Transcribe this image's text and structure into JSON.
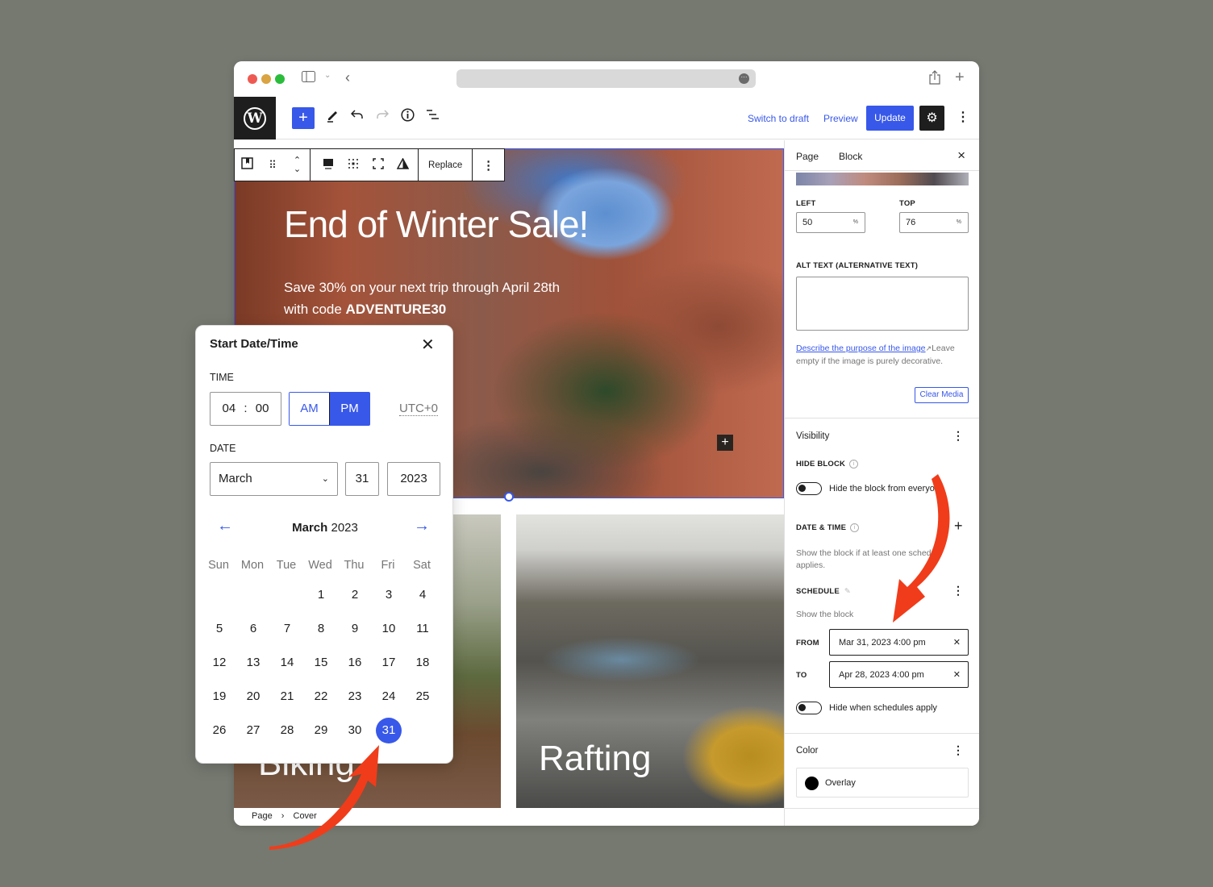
{
  "browser": {
    "window_controls": [
      "close",
      "minimize",
      "zoom"
    ],
    "icons": [
      "sidebar-toggle-icon",
      "chevron-down-icon",
      "back-icon",
      "share-icon",
      "new-tab-icon"
    ]
  },
  "toolbar": {
    "add_label": "+",
    "switch_to_draft": "Switch to draft",
    "preview": "Preview",
    "update": "Update"
  },
  "block_toolbar": {
    "replace": "Replace"
  },
  "hero": {
    "title": "End of Winter Sale!",
    "subtitle_line1": "Save 30% on your next trip through April 28th",
    "subtitle_line2_prefix": "with code ",
    "subtitle_code": "ADVENTURE30"
  },
  "tiles": [
    {
      "title": "Biking"
    },
    {
      "title": "Rafting"
    }
  ],
  "breadcrumb": {
    "items": [
      "Page",
      "Cover"
    ],
    "separator": "›"
  },
  "sidebar": {
    "tabs": [
      {
        "label": "Page"
      },
      {
        "label": "Block",
        "active": true
      }
    ],
    "focal_point": {
      "left_label": "LEFT",
      "left_value": "50",
      "top_label": "TOP",
      "top_value": "76",
      "unit": "%"
    },
    "alt_text": {
      "label": "ALT TEXT (ALTERNATIVE TEXT)",
      "value": "",
      "help_link": "Describe the purpose of the image",
      "help_text": "Leave empty if the image is purely decorative."
    },
    "clear_media": "Clear Media",
    "visibility": {
      "title": "Visibility",
      "hide_block_label": "HIDE BLOCK",
      "hide_toggle_label": "Hide the block from everyone",
      "hide_toggle_on": false,
      "date_time_label": "DATE & TIME",
      "date_time_help": "Show the block if at least one schedule applies.",
      "schedule_label": "SCHEDULE",
      "schedule_sub": "Show the block",
      "from_label": "FROM",
      "from_value": "Mar 31, 2023 4:00 pm",
      "to_label": "TO",
      "to_value": "Apr 28, 2023 4:00 pm",
      "hide_when_label": "Hide when schedules apply",
      "hide_when_on": false
    },
    "color": {
      "title": "Color",
      "overlay_label": "Overlay",
      "overlay_color": "#000000"
    }
  },
  "datepicker": {
    "title": "Start Date/Time",
    "time_label": "TIME",
    "hours": "04",
    "minutes": "00",
    "time_sep": ":",
    "am": "AM",
    "pm": "PM",
    "selected_period": "PM",
    "timezone": "UTC+0",
    "date_label": "DATE",
    "month": "March",
    "day": "31",
    "year": "2023",
    "calendar_month": "March",
    "calendar_year": "2023",
    "weekdays": [
      "Sun",
      "Mon",
      "Tue",
      "Wed",
      "Thu",
      "Fri",
      "Sat"
    ],
    "first_weekday_index": 3,
    "days_in_month": 31,
    "selected_day": 31
  },
  "colors": {
    "accent": "#3858e9",
    "annotation_arrow": "#f03c1a",
    "background": "#757970"
  }
}
